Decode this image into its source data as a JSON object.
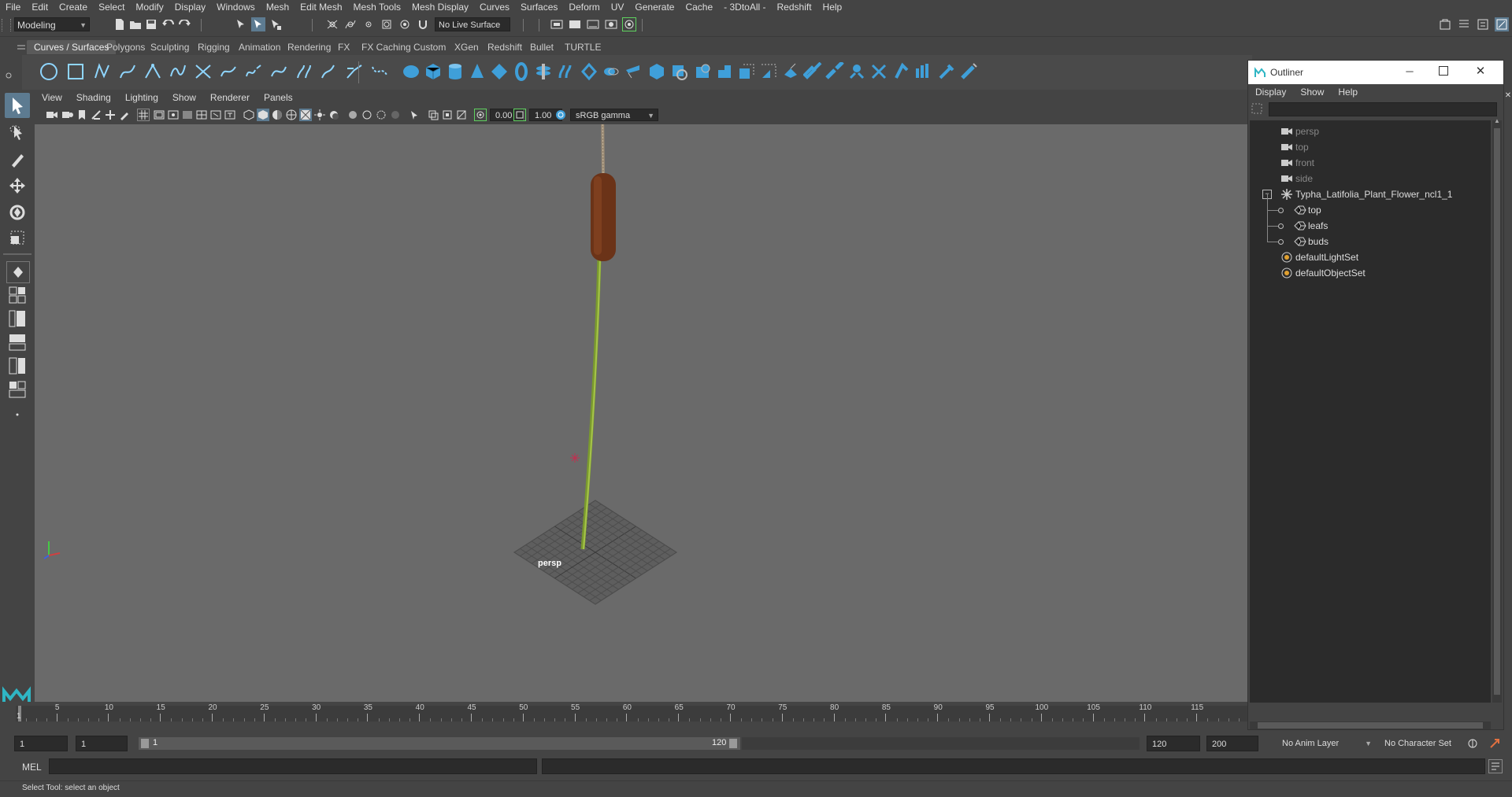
{
  "menubar": [
    "File",
    "Edit",
    "Create",
    "Select",
    "Modify",
    "Display",
    "Windows",
    "Mesh",
    "Edit Mesh",
    "Mesh Tools",
    "Mesh Display",
    "Curves",
    "Surfaces",
    "Deform",
    "UV",
    "Generate",
    "Cache",
    "- 3DtoAll -",
    "Redshift",
    "Help"
  ],
  "status": {
    "mode": "Modeling",
    "live_surface": "No Live Surface"
  },
  "shelf": {
    "tabs": [
      "Curves / Surfaces",
      "Polygons",
      "Sculpting",
      "Rigging",
      "Animation",
      "Rendering",
      "FX",
      "FX Caching",
      "Custom",
      "XGen",
      "Redshift",
      "Bullet",
      "TURTLE"
    ],
    "active_tab": 0
  },
  "viewport": {
    "menu": [
      "View",
      "Shading",
      "Lighting",
      "Show",
      "Renderer",
      "Panels"
    ],
    "exposure": "0.00",
    "gamma": "1.00",
    "color_space": "sRGB gamma",
    "camera_label": "persp"
  },
  "timeline": {
    "ticks": [
      "5",
      "10",
      "15",
      "20",
      "25",
      "30",
      "35",
      "40",
      "45",
      "50",
      "55",
      "60",
      "65",
      "70",
      "75",
      "80",
      "85",
      "90",
      "95",
      "100",
      "105",
      "110",
      "115"
    ],
    "current_frame": "1"
  },
  "range": {
    "start": "1",
    "playback_start": "1",
    "slider_start": "1",
    "slider_end": "120",
    "playback_end": "120",
    "end": "200",
    "anim_layer": "No Anim Layer",
    "character_set": "No Character Set"
  },
  "cmdline": {
    "lang": "MEL"
  },
  "helpline": {
    "text": "Select Tool: select an object"
  },
  "outliner": {
    "title": "Outliner",
    "menu": [
      "Display",
      "Show",
      "Help"
    ],
    "rows": [
      {
        "label": "persp",
        "type": "camera",
        "dim": true,
        "indent": 0
      },
      {
        "label": "top",
        "type": "camera",
        "dim": true,
        "indent": 0
      },
      {
        "label": "front",
        "type": "camera",
        "dim": true,
        "indent": 0
      },
      {
        "label": "side",
        "type": "camera",
        "dim": true,
        "indent": 0
      },
      {
        "label": "Typha_Latifolia_Plant_Flower_ncl1_1",
        "type": "group",
        "dim": false,
        "indent": 0
      },
      {
        "label": "top",
        "type": "mesh",
        "dim": false,
        "indent": 1
      },
      {
        "label": "leafs",
        "type": "mesh",
        "dim": false,
        "indent": 1
      },
      {
        "label": "buds",
        "type": "mesh",
        "dim": false,
        "indent": 1
      },
      {
        "label": "defaultLightSet",
        "type": "set",
        "dim": false,
        "indent": 0
      },
      {
        "label": "defaultObjectSet",
        "type": "set",
        "dim": false,
        "indent": 0
      }
    ]
  },
  "colors": {
    "accent": "#5d7b91",
    "stem": "#8aa23a",
    "flower": "#6b3318",
    "grid": "#555555",
    "background": "#6a6a6a"
  }
}
